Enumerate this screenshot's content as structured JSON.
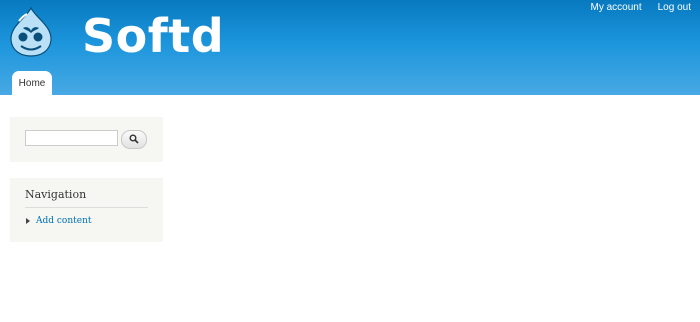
{
  "header": {
    "site_name": "Softd",
    "logo_icon": "drupal-drop-icon",
    "secondary_menu": [
      "My account",
      "Log out"
    ],
    "colors": {
      "gradient_top": "#0779bf",
      "gradient_bottom": "#48a9e4"
    }
  },
  "main_menu": {
    "tabs": [
      {
        "label": "Home",
        "active": true
      }
    ]
  },
  "sidebar": {
    "search": {
      "input_value": "",
      "button_icon": "search-icon"
    },
    "navigation": {
      "title": "Navigation",
      "items": [
        {
          "label": "Add content"
        }
      ],
      "link_color": "#0071b3"
    }
  }
}
